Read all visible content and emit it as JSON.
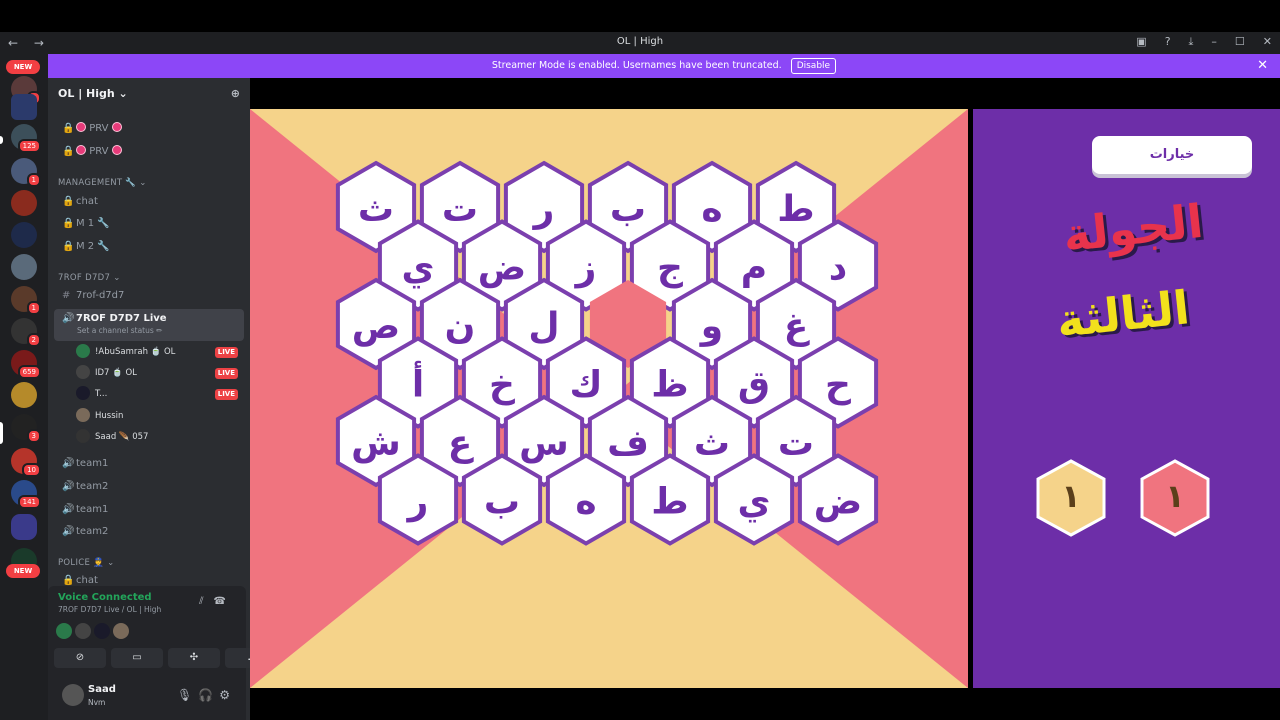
{
  "window": {
    "title": "OL | High"
  },
  "banner": {
    "text": "Streamer Mode is enabled. Usernames have been truncated.",
    "button": "Disable"
  },
  "server_rail": {
    "top_new": "NEW",
    "bottom_new": "NEW",
    "badges": [
      "3",
      "125",
      "1",
      "1",
      "2",
      "659",
      "3",
      "10",
      "141"
    ]
  },
  "sidebar": {
    "guild_name": "OL | High",
    "channels_top": [
      {
        "label": "PRV"
      },
      {
        "label": "PRV"
      }
    ],
    "management": {
      "label": "MANAGEMENT 🔧",
      "channels": [
        "chat",
        "M 1 🔧",
        "M 2 🔧"
      ]
    },
    "trof": {
      "label": "7ROF D7D7",
      "text_channel": "7rof-d7d7",
      "voice_channel": "7ROF D7D7 Live",
      "status": "Set a channel status ✏",
      "users": [
        {
          "name": "!AbuSamrah",
          "tag": "OL",
          "live": "LIVE"
        },
        {
          "name": "ID7",
          "tag": "OL",
          "live": "LIVE"
        },
        {
          "name": "T...",
          "tag": "",
          "live": "LIVE"
        },
        {
          "name": "Hussin",
          "tag": "",
          "live": ""
        },
        {
          "name": "Saad",
          "tag": "057",
          "live": ""
        }
      ]
    },
    "team_channels": [
      "team1",
      "team2",
      "team1",
      "team2"
    ],
    "police": {
      "label": "POLICE 👮",
      "channel": "chat"
    }
  },
  "voice_panel": {
    "status": "Voice Connected",
    "location": "7ROF D7D7 Live / OL | High"
  },
  "user": {
    "name": "Saad",
    "status": "Nvm"
  },
  "game": {
    "options_button": "خيارات",
    "round_line1": "الجولة",
    "round_line2": "الثالثة",
    "score_yellow": "١",
    "score_red": "١",
    "colors": {
      "yellow": "#f5d38a",
      "red": "#f0747f",
      "purple": "#6d2ea8",
      "hex_stroke": "#7b3fae"
    },
    "hex_rows": [
      [
        "ث",
        "ت",
        "ر",
        "ب",
        "ه",
        "ط"
      ],
      [
        "ي",
        "ض",
        "ز",
        "ج",
        "م",
        "د"
      ],
      [
        "ص",
        "ن",
        "ل",
        "",
        "و",
        "غ"
      ],
      [
        "أ",
        "خ",
        "ك",
        "ظ",
        "ق",
        "ح"
      ],
      [
        "ش",
        "ع",
        "س",
        "ف",
        "ث",
        "ت"
      ],
      [
        "ر",
        "ب",
        "ه",
        "ط",
        "ي",
        "ض"
      ]
    ]
  }
}
